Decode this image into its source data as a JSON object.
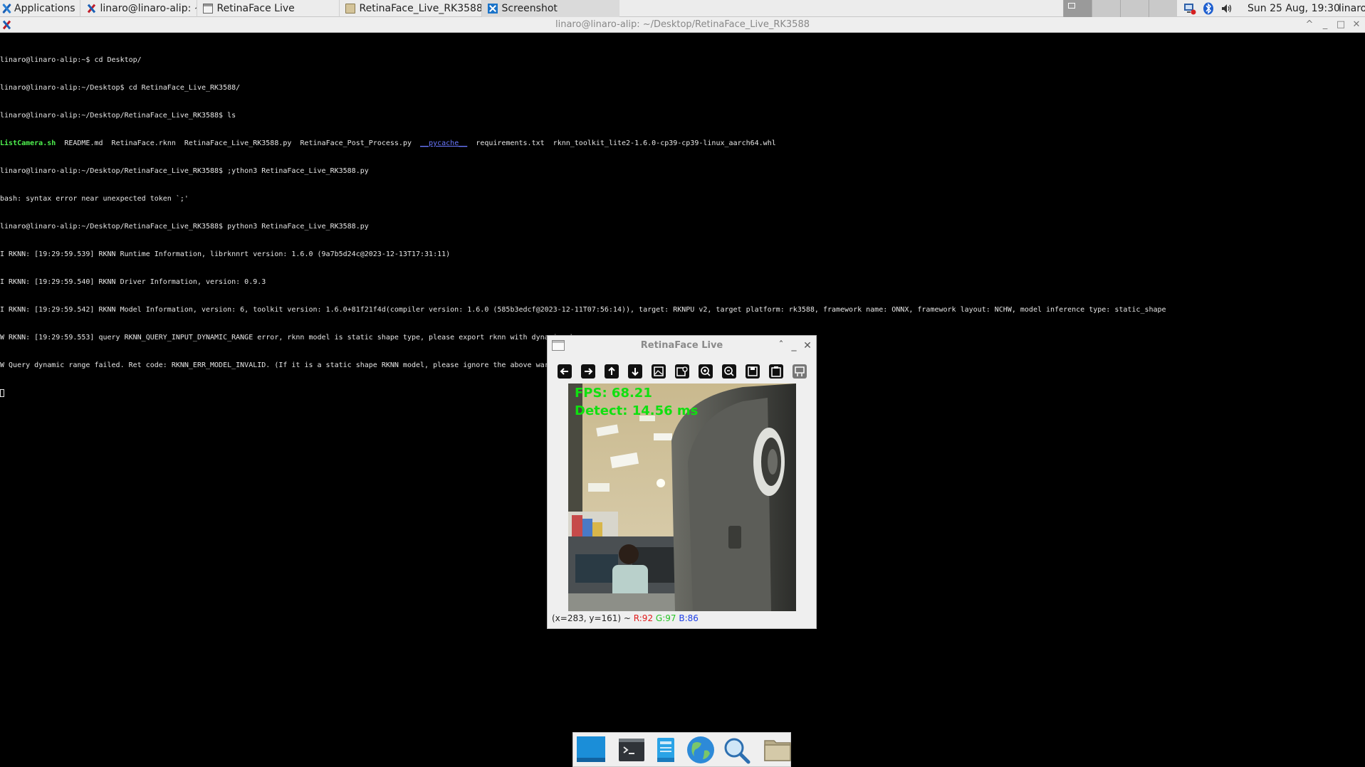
{
  "top_panel": {
    "applications_label": "Applications",
    "tasks": [
      {
        "label": "linaro@linaro-alip: ~/De...",
        "icon": "terminal-app-icon"
      },
      {
        "label": "RetinaFace Live",
        "icon": "window-icon"
      },
      {
        "label": "RetinaFace_Live_RK3588",
        "icon": "folder-icon"
      },
      {
        "label": "Screenshot",
        "icon": "screenshot-icon"
      }
    ],
    "clock": "Sun 25 Aug, 19:30",
    "user": "linaro"
  },
  "terminal": {
    "title": "linaro@linaro-alip: ~/Desktop/RetinaFace_Live_RK3588",
    "lines": [
      "linaro@linaro-alip:~$ cd Desktop/",
      "linaro@linaro-alip:~/Desktop$ cd RetinaFace_Live_RK3588/",
      "linaro@linaro-alip:~/Desktop/RetinaFace_Live_RK3588$ ls",
      "",
      "linaro@linaro-alip:~/Desktop/RetinaFace_Live_RK3588$ ;ython3 RetinaFace_Live_RK3588.py",
      "bash: syntax error near unexpected token `;'",
      "linaro@linaro-alip:~/Desktop/RetinaFace_Live_RK3588$ python3 RetinaFace_Live_RK3588.py",
      "I RKNN: [19:29:59.539] RKNN Runtime Information, librknnrt version: 1.6.0 (9a7b5d24c@2023-12-13T17:31:11)",
      "I RKNN: [19:29:59.540] RKNN Driver Information, version: 0.9.3",
      "I RKNN: [19:29:59.542] RKNN Model Information, version: 6, toolkit version: 1.6.0+81f21f4d(compiler version: 1.6.0 (585b3edcf@2023-12-11T07:56:14)), target: RKNPU v2, target platform: rk3588, framework name: ONNX, framework layout: NCHW, model inference type: static_shape",
      "W RKNN: [19:29:59.553] query RKNN_QUERY_INPUT_DYNAMIC_RANGE error, rknn model is static shape type, please export rknn with dynamic_shapes",
      "W Query dynamic range failed. Ret code: RKNN_ERR_MODEL_INVALID. (If it is a static shape RKNN model, please ignore the above warning message.)"
    ],
    "ls_output": {
      "script": "ListCamera.sh",
      "files_a": "  README.md  RetinaFace.rknn  RetinaFace_Live_RK3588.py  RetinaFace_Post_Process.py  ",
      "dir": "__pycache__",
      "files_b": "  requirements.txt  rknn_toolkit_lite2-1.6.0-cp39-cp39-linux_aarch64.whl"
    }
  },
  "viewer": {
    "title": "RetinaFace Live",
    "toolbar": [
      {
        "name": "pan-left-button",
        "icon": "arrow-left-icon"
      },
      {
        "name": "pan-right-button",
        "icon": "arrow-right-icon"
      },
      {
        "name": "pan-up-button",
        "icon": "arrow-up-icon"
      },
      {
        "name": "pan-down-button",
        "icon": "arrow-down-icon"
      },
      {
        "name": "zoom-fit-button",
        "icon": "image-fit-icon"
      },
      {
        "name": "zoom-original-button",
        "icon": "image-original-icon"
      },
      {
        "name": "zoom-in-button",
        "icon": "zoom-in-icon"
      },
      {
        "name": "zoom-out-button",
        "icon": "zoom-out-icon"
      },
      {
        "name": "save-image-button",
        "icon": "save-icon"
      },
      {
        "name": "copy-image-button",
        "icon": "clipboard-icon"
      },
      {
        "name": "properties-button",
        "icon": "properties-icon"
      }
    ],
    "overlay": {
      "fps": "FPS: 68.21",
      "detect": "Detect: 14.56 ms"
    },
    "status": {
      "coords": "(x=283, y=161) ~ ",
      "r": "R:92",
      "g": "G:97",
      "b": "B:86"
    }
  },
  "dock": {
    "items": [
      "show-desktop-icon",
      "terminal-icon",
      "file-manager-icon",
      "web-browser-icon",
      "app-finder-icon",
      "home-folder-icon"
    ]
  },
  "colors": {
    "overlay_text": "#10e010",
    "terminal_bg": "#000000",
    "panel_bg": "#ececec"
  }
}
